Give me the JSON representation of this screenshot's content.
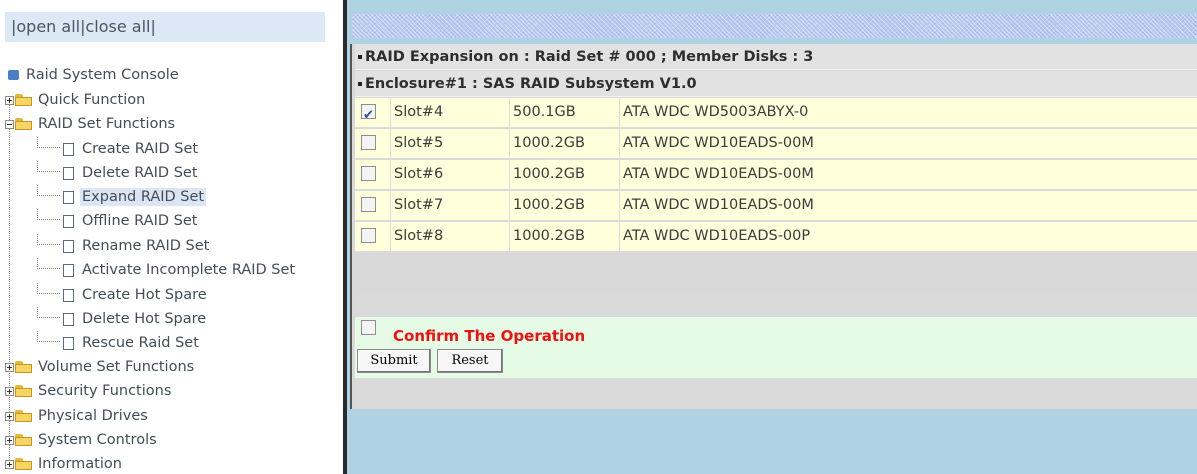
{
  "tree": {
    "toggle": {
      "open_all": "open all",
      "close_all": "close all"
    },
    "root_label": "Raid System Console",
    "items": [
      {
        "label": "Quick Function",
        "type": "folder",
        "expanded": false
      },
      {
        "label": "RAID Set Functions",
        "type": "folder",
        "expanded": true
      },
      {
        "label": "Create RAID Set",
        "type": "page"
      },
      {
        "label": "Delete RAID Set",
        "type": "page"
      },
      {
        "label": "Expand RAID Set",
        "type": "page",
        "selected": true
      },
      {
        "label": "Offline RAID Set",
        "type": "page"
      },
      {
        "label": "Rename RAID Set",
        "type": "page"
      },
      {
        "label": "Activate Incomplete RAID Set",
        "type": "page"
      },
      {
        "label": "Create Hot Spare",
        "type": "page"
      },
      {
        "label": "Delete Hot Spare",
        "type": "page"
      },
      {
        "label": "Rescue Raid Set",
        "type": "page"
      },
      {
        "label": "Volume Set Functions",
        "type": "folder",
        "expanded": false
      },
      {
        "label": "Security Functions",
        "type": "folder",
        "expanded": false
      },
      {
        "label": "Physical Drives",
        "type": "folder",
        "expanded": false
      },
      {
        "label": "System Controls",
        "type": "folder",
        "expanded": false
      },
      {
        "label": "Information",
        "type": "folder",
        "expanded": false
      }
    ]
  },
  "main": {
    "header": "RAID Expansion on : Raid Set # 000 ; Member Disks : 3",
    "enclosure": "Enclosure#1 : SAS RAID Subsystem V1.0",
    "disks": [
      {
        "slot": "Slot#4",
        "size": "500.1GB",
        "model": "ATA WDC WD5003ABYX-0",
        "checked": true
      },
      {
        "slot": "Slot#5",
        "size": "1000.2GB",
        "model": "ATA WDC WD10EADS-00M",
        "checked": false
      },
      {
        "slot": "Slot#6",
        "size": "1000.2GB",
        "model": "ATA WDC WD10EADS-00M",
        "checked": false
      },
      {
        "slot": "Slot#7",
        "size": "1000.2GB",
        "model": "ATA WDC WD10EADS-00M",
        "checked": false
      },
      {
        "slot": "Slot#8",
        "size": "1000.2GB",
        "model": "ATA WDC WD10EADS-00P",
        "checked": false
      }
    ],
    "confirm_label": "Confirm The Operation",
    "confirm_checked": false,
    "submit_label": "Submit",
    "reset_label": "Reset"
  },
  "colors": {
    "confirm_text": "#ee1111",
    "row_bg": "#ffffdb",
    "confirm_bg": "#e6fbe6",
    "right_bg": "#b0d3e3"
  }
}
